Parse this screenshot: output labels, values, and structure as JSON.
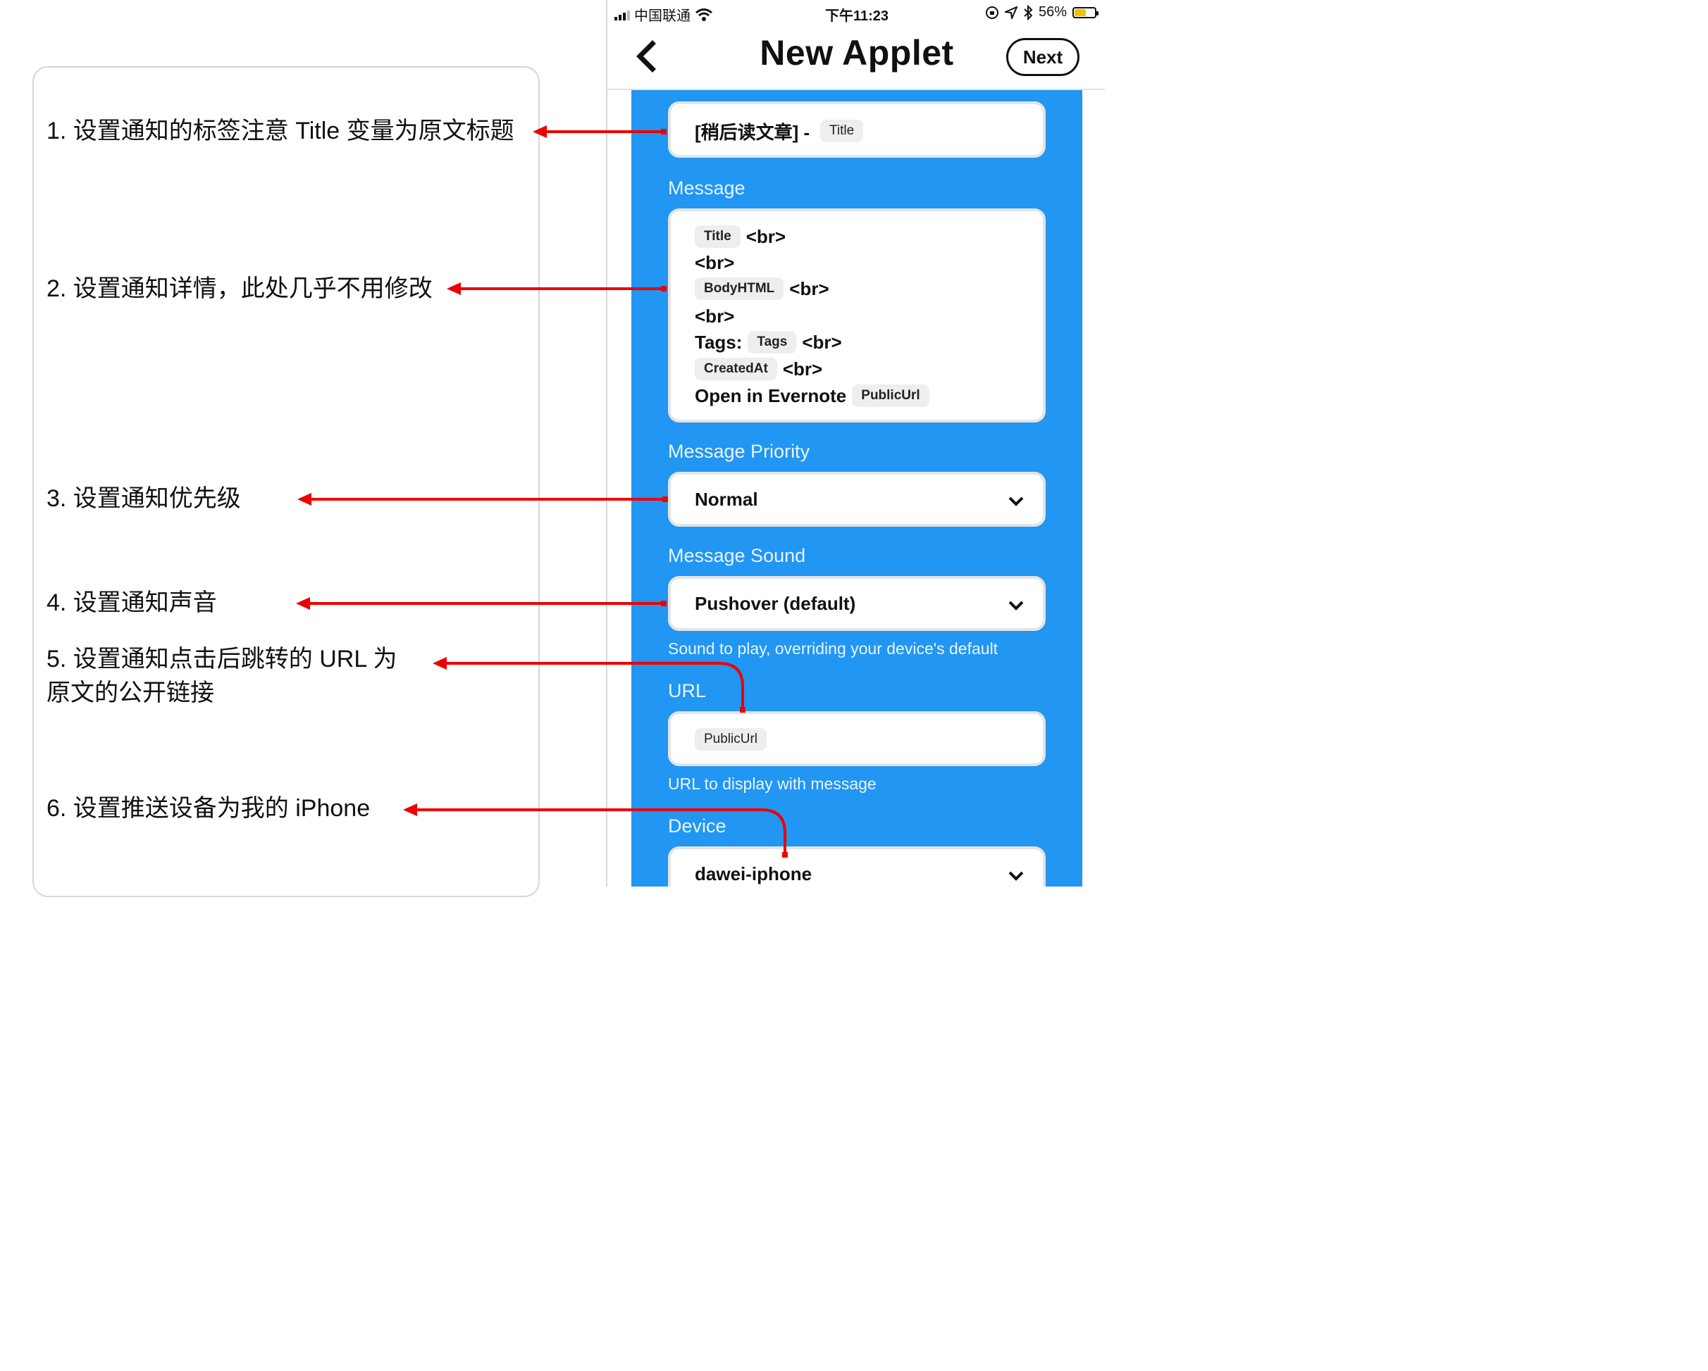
{
  "notes": [
    "1. 设置通知的标签注意 Title 变量为原文标题",
    "2. 设置通知详情，此处几乎不用修改",
    "3. 设置通知优先级",
    "4. 设置通知声音",
    "5. 设置通知点击后跳转的 URL 为",
    "原文的公开链接",
    "6. 设置推送设备为我的 iPhone"
  ],
  "status_bar": {
    "carrier": "中国联通",
    "time": "下午11:23",
    "battery": "56%",
    "battery_level": 0.56
  },
  "nav": {
    "title": "New Applet",
    "next_label": "Next"
  },
  "form": {
    "title_field": {
      "prefix": "[稍后读文章] -",
      "ingredient": "Title"
    },
    "message": {
      "label": "Message",
      "lines": {
        "l1_ingredient": "Title",
        "l1_text": "<br>",
        "l2_text": "<br>",
        "l3_ingredient": "BodyHTML",
        "l3_text": "<br>",
        "l4_text": "<br>",
        "l5_prefix": "Tags:",
        "l5_ingredient": "Tags",
        "l5_text": "<br>",
        "l6_ingredient": "CreatedAt",
        "l6_text": "<br>",
        "l7_prefix": "Open in Evernote",
        "l7_ingredient": "PublicUrl"
      }
    },
    "priority": {
      "label": "Message Priority",
      "value": "Normal"
    },
    "sound": {
      "label": "Message Sound",
      "value": "Pushover (default)",
      "helper": "Sound to play, overriding your device's default"
    },
    "url": {
      "label": "URL",
      "ingredient": "PublicUrl",
      "helper": "URL to display with message"
    },
    "device": {
      "label": "Device",
      "value": "dawei-iphone"
    }
  },
  "colors": {
    "form_background": "#2196f3",
    "arrow": "#ee0000",
    "battery": "#f2c200"
  }
}
